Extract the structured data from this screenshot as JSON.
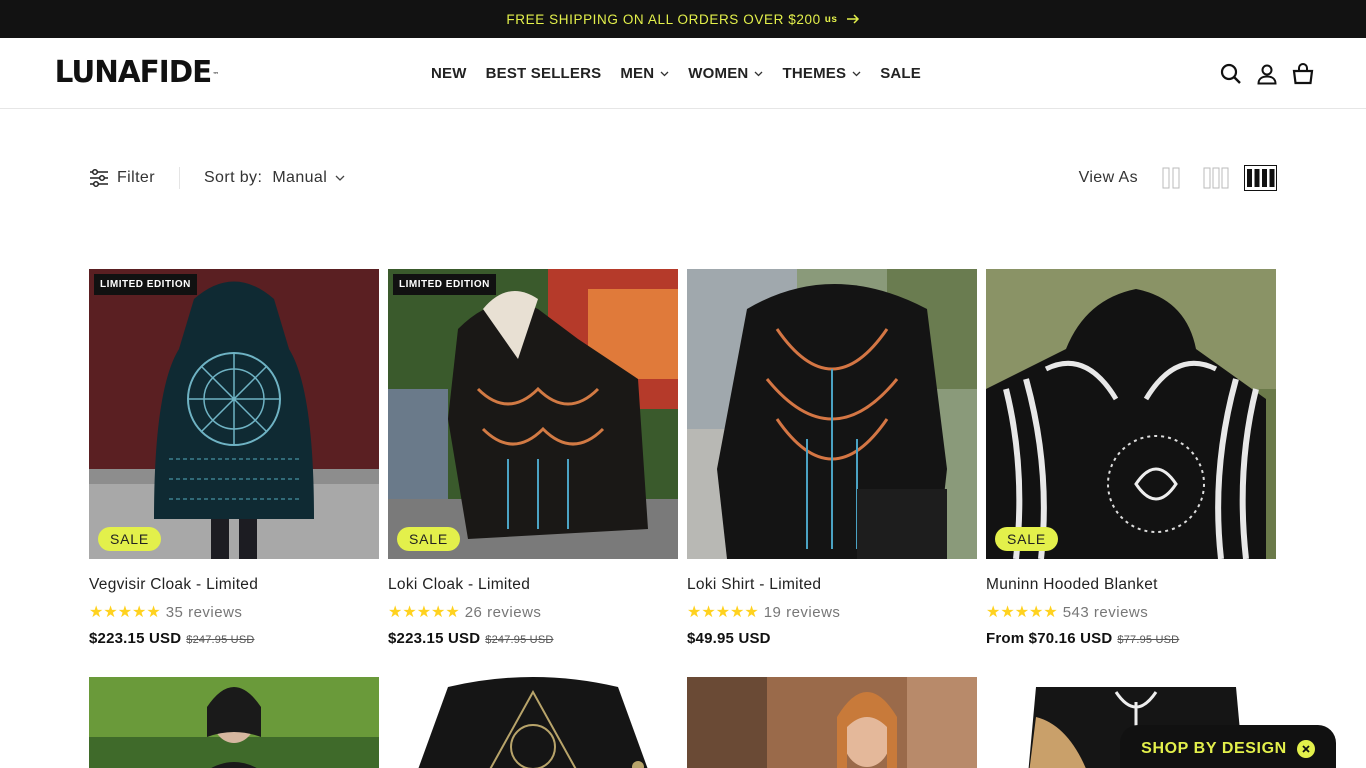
{
  "announcement": {
    "text": "FREE SHIPPING ON ALL ORDERS OVER $200",
    "currency": "us"
  },
  "brand": {
    "logo": "LUNAFIDE",
    "tm": "™",
    "accent": "#e3f04b",
    "dark": "#121212"
  },
  "nav": [
    {
      "label": "NEW",
      "dropdown": false
    },
    {
      "label": "BEST SELLERS",
      "dropdown": false
    },
    {
      "label": "MEN",
      "dropdown": true
    },
    {
      "label": "WOMEN",
      "dropdown": true
    },
    {
      "label": "THEMES",
      "dropdown": true
    },
    {
      "label": "SALE",
      "dropdown": false
    }
  ],
  "header_icons": [
    "search-icon",
    "account-icon",
    "cart-icon"
  ],
  "toolbar": {
    "filter_label": "Filter",
    "sort_label": "Sort by:",
    "sort_value": "Manual",
    "view_as_label": "View As",
    "view_options": [
      "2-column",
      "3-column",
      "4-column"
    ],
    "view_selected": "4-column"
  },
  "products": [
    {
      "name": "Vegvisir Cloak - Limited",
      "reviews": "35 reviews",
      "rating": 5,
      "price": "$223.15 USD",
      "compare": "$247.95 USD",
      "limited": "LIMITED EDITION",
      "sale": "SALE"
    },
    {
      "name": "Loki Cloak - Limited",
      "reviews": "26 reviews",
      "rating": 5,
      "price": "$223.15 USD",
      "compare": "$247.95 USD",
      "limited": "LIMITED EDITION",
      "sale": "SALE"
    },
    {
      "name": "Loki Shirt - Limited",
      "reviews": "19 reviews",
      "rating": 5,
      "price": "$49.95 USD",
      "compare": "",
      "limited": "",
      "sale": ""
    },
    {
      "name": "Muninn Hooded Blanket",
      "reviews": "543 reviews",
      "rating": 5,
      "price": "From $70.16 USD",
      "compare": "$77.95 USD",
      "limited": "",
      "sale": "SALE"
    }
  ],
  "stars": "★★★★★",
  "floating": {
    "label": "SHOP BY DESIGN"
  }
}
